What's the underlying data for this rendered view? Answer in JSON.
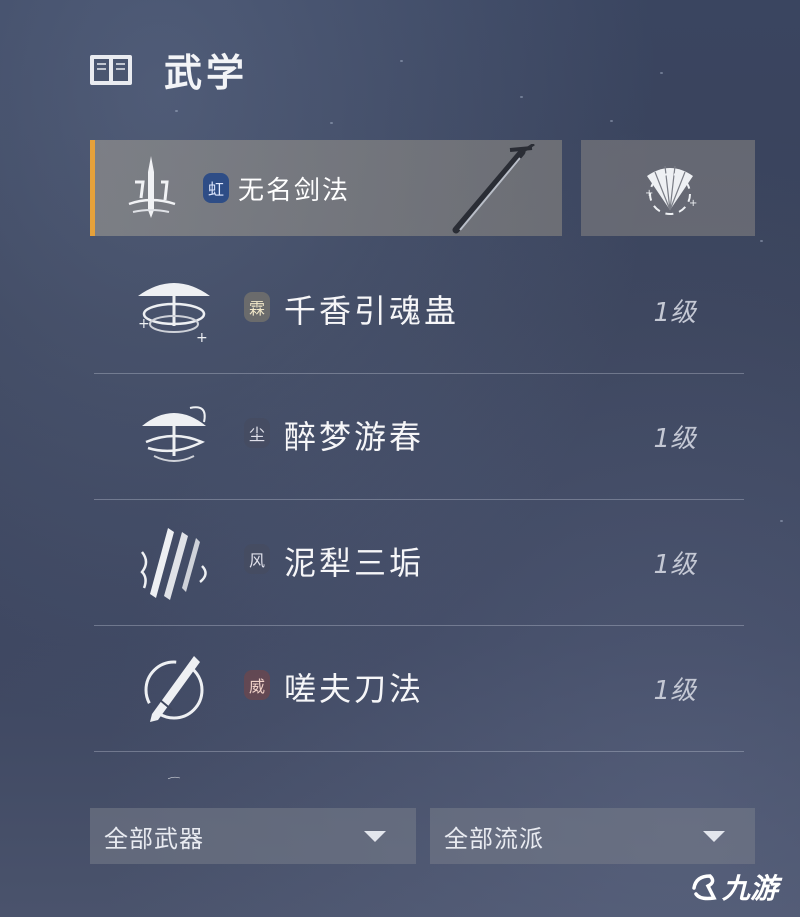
{
  "header": {
    "title": "武学",
    "icon": "book-icon"
  },
  "selected_skill": {
    "badge": "虹",
    "name": "无名剑法",
    "icon": "sword-stance-icon",
    "weapon_icon": "sword-icon"
  },
  "side_button": {
    "icon": "fan-icon"
  },
  "skills": [
    {
      "badge": "霖",
      "name": "千香引魂蛊",
      "level": "1级",
      "icon": "umbrella-swirl-icon",
      "badge_style": "tan"
    },
    {
      "badge": "尘",
      "name": "醉梦游春",
      "level": "1级",
      "icon": "umbrella-spin-icon",
      "badge_style": "dark"
    },
    {
      "badge": "风",
      "name": "泥犁三垢",
      "level": "1级",
      "icon": "triple-blade-icon",
      "badge_style": "dark"
    },
    {
      "badge": "威",
      "name": "嗟夫刀法",
      "level": "1级",
      "icon": "blade-circle-icon",
      "badge_style": "red"
    }
  ],
  "filters": {
    "weapons": {
      "label": "全部武器"
    },
    "schools": {
      "label": "全部流派"
    }
  },
  "watermark": {
    "text": "九游"
  },
  "colors": {
    "accent": "#e6a13a",
    "badge_blue": "#2e4d86"
  }
}
